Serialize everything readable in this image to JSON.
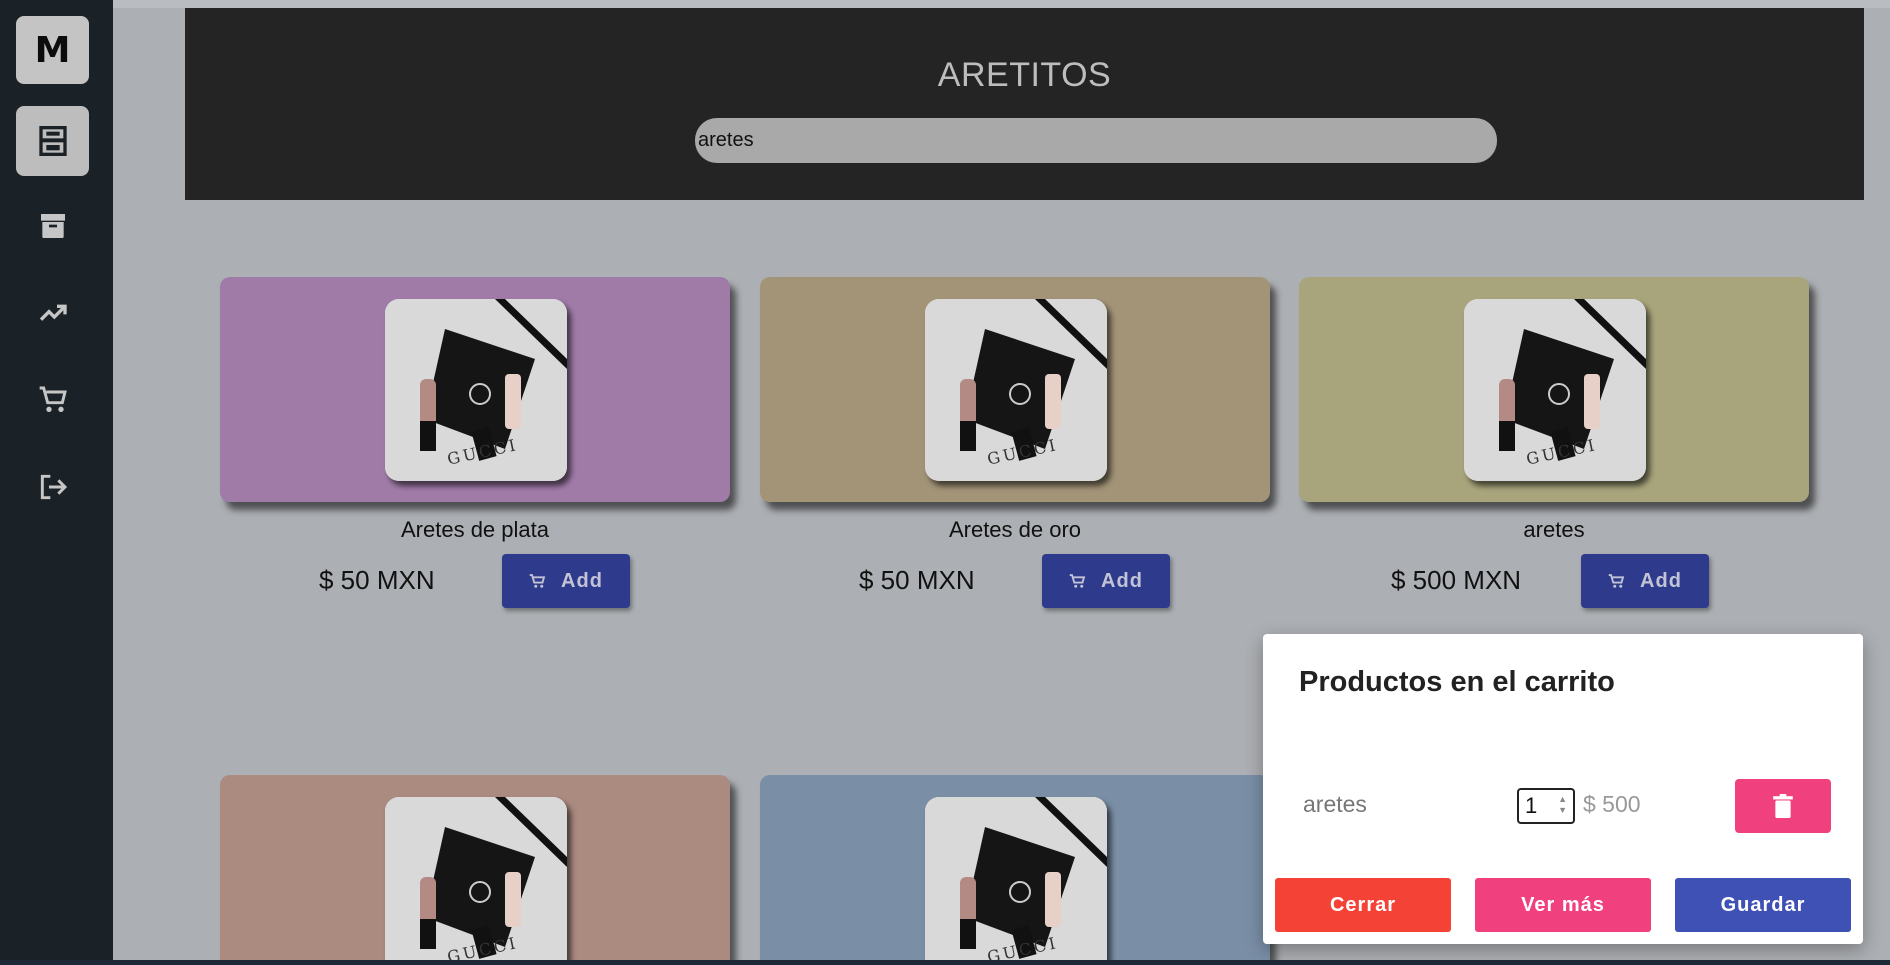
{
  "sidebar": {
    "logo": "M",
    "items": [
      {
        "icon": "storefront-icon",
        "active": true
      },
      {
        "icon": "archive-icon",
        "active": false
      },
      {
        "icon": "trending-up-icon",
        "active": false
      },
      {
        "icon": "cart-icon",
        "active": false
      },
      {
        "icon": "logout-icon",
        "active": false
      }
    ]
  },
  "header": {
    "title": "ARETITOS",
    "search_value": "aretes"
  },
  "products": [
    {
      "name": "Aretes de plata",
      "price": "$ 50 MXN",
      "add_label": "Add",
      "color": "#a07ba8"
    },
    {
      "name": "Aretes de oro",
      "price": "$ 50 MXN",
      "add_label": "Add",
      "color": "#a39478"
    },
    {
      "name": "aretes",
      "price": "$ 500 MXN",
      "add_label": "Add",
      "color": "#a8a57c"
    },
    {
      "name": "",
      "price": "",
      "add_label": "",
      "color": "#ab8a80"
    },
    {
      "name": "",
      "price": "",
      "add_label": "",
      "color": "#7a8ea6"
    }
  ],
  "cart": {
    "title": "Productos en el carrito",
    "items": [
      {
        "name": "aretes",
        "quantity": "1",
        "price": "$ 500"
      }
    ],
    "buttons": {
      "close": "Cerrar",
      "more": "Ver más",
      "save": "Guardar"
    }
  },
  "colors": {
    "sidebar_bg": "#1b2227",
    "header_bg": "#242424",
    "primary": "#3f51b5",
    "accent": "#f0417e",
    "danger": "#f44336"
  }
}
